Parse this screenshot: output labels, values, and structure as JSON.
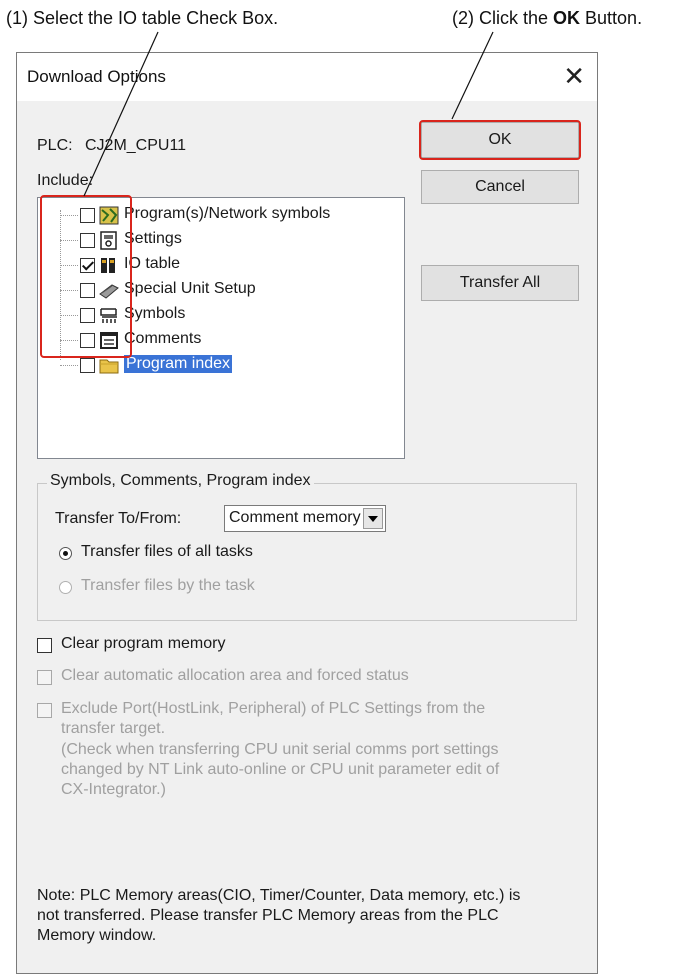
{
  "callouts": {
    "step1": "(1) Select the IO table Check Box.",
    "step2_prefix": "(2) Click the ",
    "step2_bold": "OK",
    "step2_suffix": " Button."
  },
  "dialog": {
    "title": "Download Options",
    "close_glyph": "✕",
    "plc_label": "PLC:",
    "plc_value": "CJ2M_CPU11",
    "include_label": "Include:"
  },
  "buttons": {
    "ok": "OK",
    "cancel": "Cancel",
    "transfer_all": "Transfer All"
  },
  "tree_items": [
    {
      "label": "Program(s)/Network symbols",
      "checked": false,
      "icon": "program-network-icon"
    },
    {
      "label": "Settings",
      "checked": false,
      "icon": "settings-icon"
    },
    {
      "label": "IO table",
      "checked": true,
      "icon": "io-table-icon"
    },
    {
      "label": "Special Unit Setup",
      "checked": false,
      "icon": "special-unit-icon"
    },
    {
      "label": "Symbols",
      "checked": false,
      "icon": "symbols-icon"
    },
    {
      "label": "Comments",
      "checked": false,
      "icon": "comments-icon"
    },
    {
      "label": "Program index",
      "checked": false,
      "icon": "folder-icon",
      "selected": true
    }
  ],
  "group": {
    "title": "Symbols, Comments, Program index",
    "transfer_label": "Transfer To/From:",
    "transfer_value": "Comment memory",
    "radio_all": "Transfer files of all tasks",
    "radio_task": "Transfer files by the task"
  },
  "options": {
    "clear_program": "Clear program memory",
    "clear_auto": "Clear automatic allocation area and forced status",
    "exclude_line1": "Exclude Port(HostLink, Peripheral) of PLC Settings from the",
    "exclude_line2": "transfer target.",
    "exclude_line3": "(Check when transferring CPU unit serial comms port settings",
    "exclude_line4": "changed by NT Link auto-online or CPU unit parameter edit of",
    "exclude_line5": "CX-Integrator.)"
  },
  "note": {
    "line1": "Note: PLC Memory areas(CIO, Timer/Counter, Data memory, etc.) is",
    "line2": "not transferred. Please transfer PLC Memory areas from the PLC",
    "line3": "Memory window."
  },
  "colors": {
    "highlight": "#d9251c",
    "selection": "#3a73d6",
    "dialog_bg": "#f0f0f0"
  }
}
